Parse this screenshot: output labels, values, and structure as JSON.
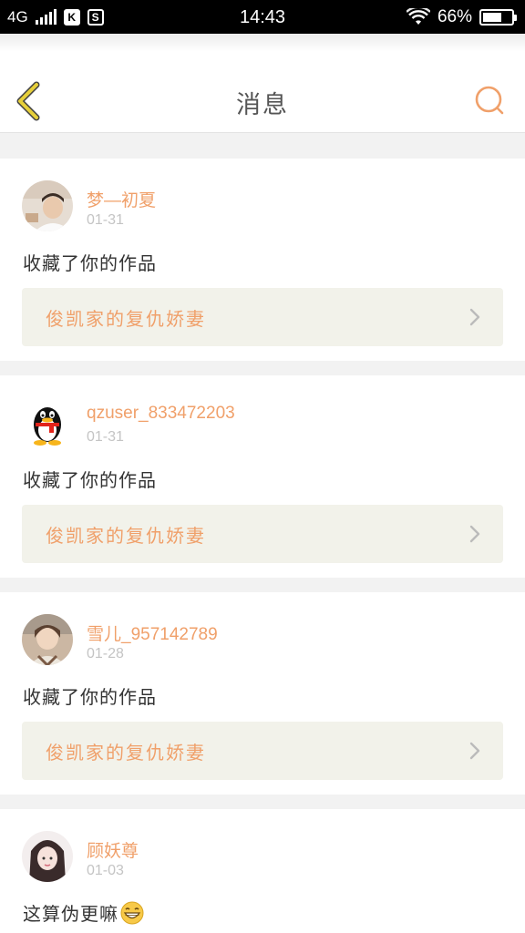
{
  "status_bar": {
    "network": "4G",
    "time": "14:43",
    "battery_percent": "66%",
    "battery_level": 0.66,
    "badges": [
      "K",
      "S"
    ]
  },
  "header": {
    "title": "消息",
    "back_icon": "chevron-left-icon",
    "search_icon": "search-icon"
  },
  "colors": {
    "accent": "#f0a06a",
    "back_arrow": "#e6cf3a",
    "link_bg": "#f2f2ea"
  },
  "messages": [
    {
      "username": "梦—初夏",
      "date": "01-31",
      "action": "收藏了你的作品",
      "work_title": "俊凯家的复仇娇妻"
    },
    {
      "username": "qzuser_833472203",
      "date": "01-31",
      "action": "收藏了你的作品",
      "work_title": "俊凯家的复仇娇妻"
    },
    {
      "username": "雪儿_957142789",
      "date": "01-28",
      "action": "收藏了你的作品",
      "work_title": "俊凯家的复仇娇妻"
    },
    {
      "username": "顾妖尊",
      "date": "01-03",
      "action": "这算伪更嘛",
      "emoji": "grinning-emoji"
    }
  ]
}
